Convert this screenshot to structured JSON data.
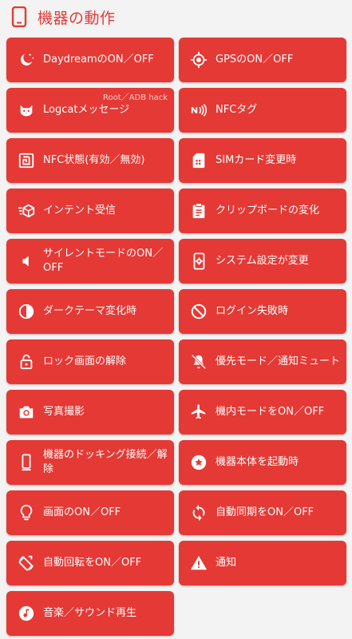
{
  "header": {
    "title": "機器の動作",
    "icon": "phone-icon"
  },
  "accent_color": "#e53935",
  "tiles": [
    {
      "label": "DaydreamのON／OFF",
      "icon": "moon-stars-icon"
    },
    {
      "label": "GPSのON／OFF",
      "icon": "gps-crosshair-icon"
    },
    {
      "label": "Logcatメッセージ",
      "icon": "cat-icon",
      "sublabel": "Root／ADB hack"
    },
    {
      "label": "NFCタグ",
      "icon": "nfc-icon"
    },
    {
      "label": "NFC状態(有効／無効)",
      "icon": "nfc-state-icon"
    },
    {
      "label": "SIMカード変更時",
      "icon": "sim-card-icon"
    },
    {
      "label": "インテント受信",
      "icon": "intent-cube-icon"
    },
    {
      "label": "クリップボードの変化",
      "icon": "clipboard-icon"
    },
    {
      "label": "サイレントモードのON／OFF",
      "icon": "speaker-icon"
    },
    {
      "label": "システム設定が変更",
      "icon": "phone-settings-icon"
    },
    {
      "label": "ダークテーマ変化時",
      "icon": "contrast-icon"
    },
    {
      "label": "ログイン失敗時",
      "icon": "block-icon"
    },
    {
      "label": "ロック画面の解除",
      "icon": "unlock-icon"
    },
    {
      "label": "優先モード／通知ミュート",
      "icon": "bell-off-icon"
    },
    {
      "label": "写真撮影",
      "icon": "camera-icon"
    },
    {
      "label": "機内モードをON／OFF",
      "icon": "airplane-icon"
    },
    {
      "label": "機器のドッキング接続／解除",
      "icon": "dock-phone-icon"
    },
    {
      "label": "機器本体を起動時",
      "icon": "star-circle-icon"
    },
    {
      "label": "画面のON／OFF",
      "icon": "lightbulb-icon"
    },
    {
      "label": "自動同期をON／OFF",
      "icon": "sync-icon"
    },
    {
      "label": "自動回転をON／OFF",
      "icon": "rotate-icon"
    },
    {
      "label": "通知",
      "icon": "warning-icon"
    },
    {
      "label": "音楽／サウンド再生",
      "icon": "music-icon"
    }
  ]
}
